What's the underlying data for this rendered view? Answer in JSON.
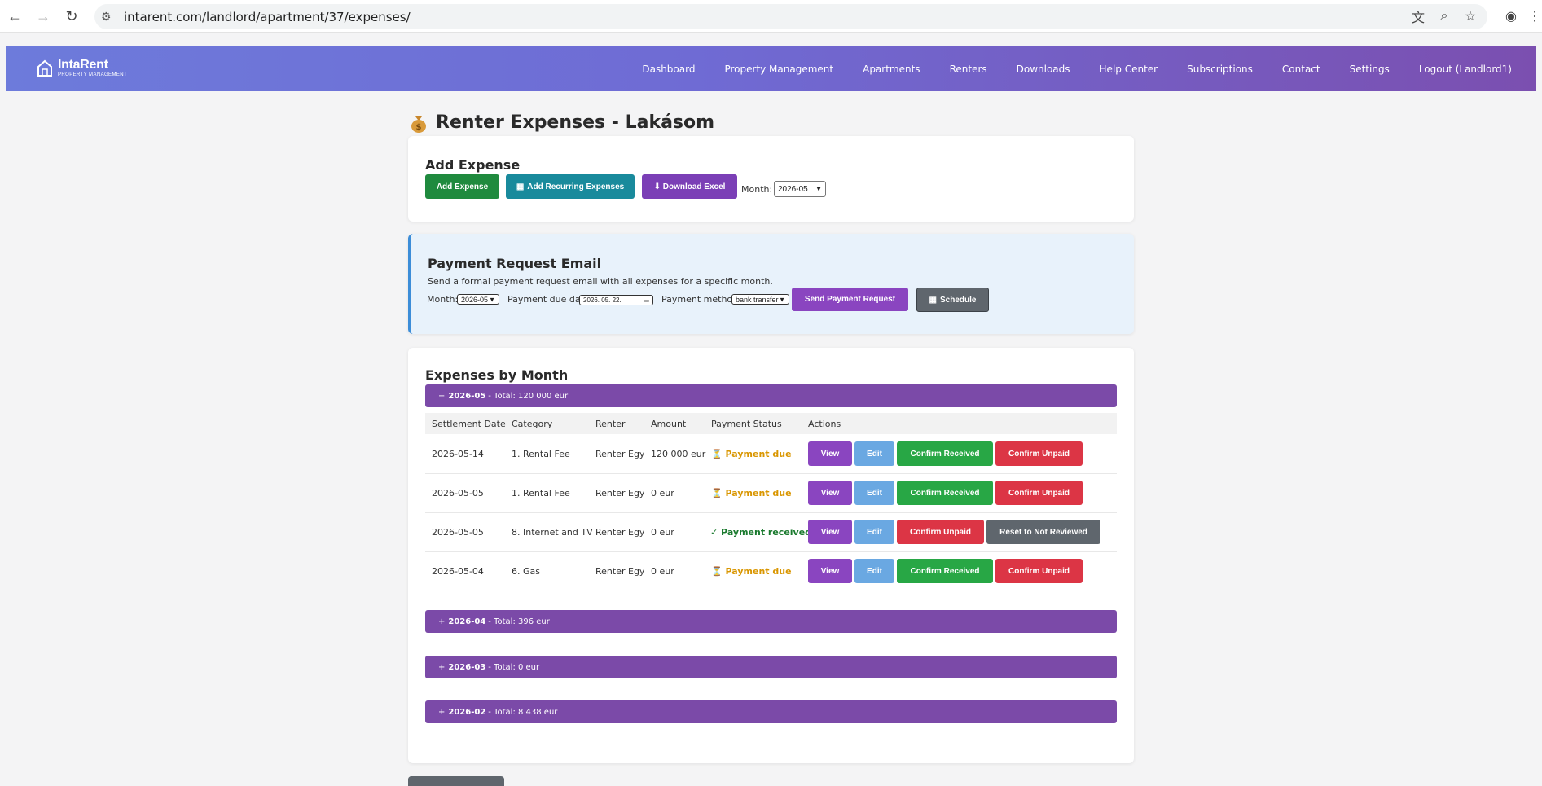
{
  "browser": {
    "url": "intarent.com/landlord/apartment/37/expenses/"
  },
  "nav": {
    "brand": "IntaRent",
    "brand_sub": "PROPERTY MANAGEMENT",
    "items": [
      "Dashboard",
      "Property Management",
      "Apartments",
      "Renters",
      "Downloads",
      "Help Center",
      "Subscriptions",
      "Contact",
      "Settings",
      "Logout (Landlord1)"
    ]
  },
  "page": {
    "title": "Renter Expenses - Lakásom"
  },
  "add_expense": {
    "heading": "Add Expense",
    "add_button": "Add Expense",
    "recurring_button": "Add Recurring Expenses",
    "download_button": "⬇ Download Excel",
    "month_label": "Month:",
    "month_value": "2026-05"
  },
  "payment_request": {
    "heading": "Payment Request Email",
    "description": "Send a formal payment request email with all expenses for a specific month.",
    "month_label": "Month:",
    "month_value": "2026-05",
    "due_label": "Payment due date",
    "due_value": "2026. 05. 22.",
    "method_label": "Payment method:",
    "method_value": "bank transfer",
    "send_button": "Send Payment Request",
    "schedule_button": "Schedule"
  },
  "expenses": {
    "heading": "Expenses by Month",
    "months": [
      {
        "toggle": "−",
        "month": "2026-05",
        "total": "- Total: 120 000 eur"
      },
      {
        "toggle": "+",
        "month": "2026-04",
        "total": "- Total: 396 eur"
      },
      {
        "toggle": "+",
        "month": "2026-03",
        "total": "- Total: 0 eur"
      },
      {
        "toggle": "+",
        "month": "2026-02",
        "total": "- Total: 8 438 eur"
      }
    ],
    "columns": [
      "Settlement Date",
      "Category",
      "Renter",
      "Amount",
      "Payment Status",
      "Actions"
    ],
    "rows": [
      {
        "date": "2026-05-14",
        "category": "1. Rental Fee",
        "renter": "Renter Egy",
        "amount": "120 000 eur",
        "status": "⏳ Payment due",
        "actions": [
          "View",
          "Edit",
          "Confirm Received",
          "Confirm Unpaid"
        ]
      },
      {
        "date": "2026-05-05",
        "category": "1. Rental Fee",
        "renter": "Renter Egy",
        "amount": "0 eur",
        "status": "⏳ Payment due",
        "actions": [
          "View",
          "Edit",
          "Confirm Received",
          "Confirm Unpaid"
        ]
      },
      {
        "date": "2026-05-05",
        "category": "8. Internet and TV",
        "renter": "Renter Egy",
        "amount": "0 eur",
        "status": "✓ Payment received",
        "actions": [
          "View",
          "Edit",
          "Confirm Unpaid",
          "Reset to Not Reviewed"
        ]
      },
      {
        "date": "2026-05-04",
        "category": "6. Gas",
        "renter": "Renter Egy",
        "amount": "0 eur",
        "status": "⏳ Payment due",
        "actions": [
          "View",
          "Edit",
          "Confirm Received",
          "Confirm Unpaid"
        ]
      }
    ]
  },
  "colors": {
    "nav_gradient_start": "#6d7bdb",
    "nav_gradient_end": "#7b4fb0",
    "month_bar": "#7b4aa8",
    "payment_due": "#d99600",
    "payment_received": "#1a7a2e"
  }
}
